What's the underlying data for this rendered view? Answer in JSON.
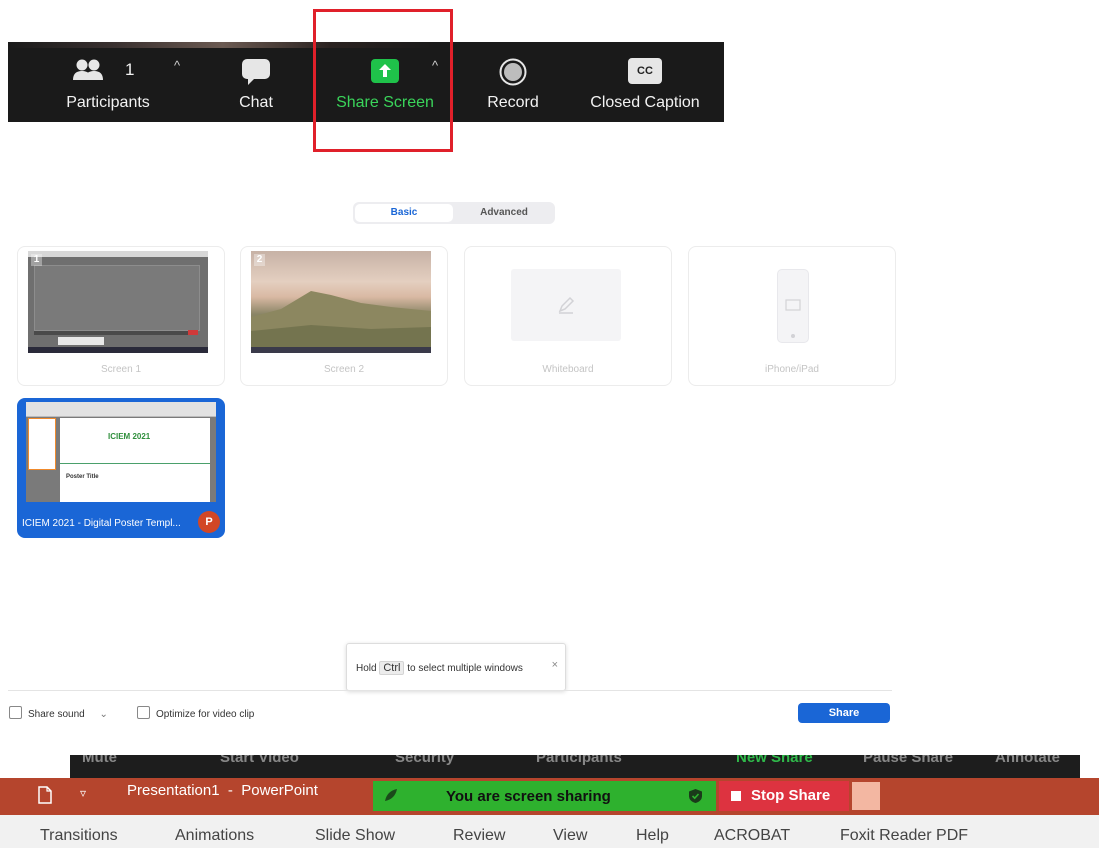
{
  "toolbar": {
    "participants_count": "1",
    "participants_label": "Participants",
    "chat_label": "Chat",
    "share_label": "Share Screen",
    "record_label": "Record",
    "cc_icon_text": "CC",
    "cc_label": "Closed Caption",
    "caret": "^"
  },
  "share_dialog": {
    "tabs": {
      "basic": "Basic",
      "advanced": "Advanced"
    },
    "items": [
      {
        "number": "1",
        "label": "Screen 1"
      },
      {
        "number": "2",
        "label": "Screen 2"
      },
      {
        "label": "Whiteboard"
      },
      {
        "label": "iPhone/iPad"
      }
    ],
    "selected_window": {
      "label": "ICIEM 2021 - Digital Poster Templ...",
      "app_badge": "P",
      "thumb_logo": "ICIEM 2021",
      "thumb_title": "Poster Title"
    },
    "tooltip": {
      "prefix": "Hold",
      "key": "Ctrl",
      "suffix": "to select multiple windows",
      "close": "×"
    },
    "share_sound": "Share sound",
    "optimize": "Optimize for video clip",
    "share_button": "Share"
  },
  "meeting_bar": {
    "items": [
      "Mute",
      "Start Video",
      "Security",
      "Participants",
      "New Share",
      "Pause Share",
      "Annotate"
    ]
  },
  "powerpoint": {
    "title": "Presentation1  -  PowerPoint",
    "sharing_text": "You are screen sharing",
    "stop_share": "Stop Share",
    "ribbon_tabs": [
      "Transitions",
      "Animations",
      "Slide Show",
      "Review",
      "View",
      "Help",
      "ACROBAT",
      "Foxit Reader PDF"
    ]
  },
  "colors": {
    "accent_blue": "#1a66d6",
    "share_green": "#3ad45a",
    "highlight_red": "#e0202a"
  }
}
